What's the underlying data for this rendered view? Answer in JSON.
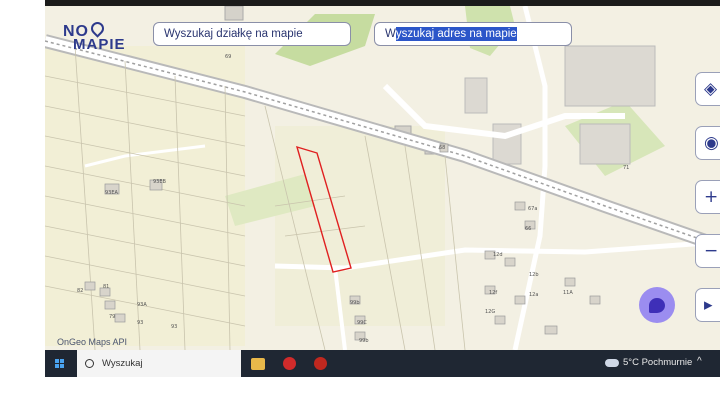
{
  "app": {
    "logo_line1": "NO",
    "logo_line2": "MAPIE"
  },
  "search": {
    "plot_placeholder": "Wyszukaj działkę na mapie",
    "address_prefix": "W",
    "address_value_selected": "yszukaj adres na mapie"
  },
  "controls": [
    {
      "name": "layers-icon",
      "glyph": "◈"
    },
    {
      "name": "locate-icon",
      "glyph": "◉"
    },
    {
      "name": "zoom-in-icon",
      "glyph": "+"
    },
    {
      "name": "zoom-out-icon",
      "glyph": "−"
    },
    {
      "name": "expand-icon",
      "glyph": "▸"
    }
  ],
  "map": {
    "attribution": "OnGeo Maps API",
    "plot_labels": [
      "93EA",
      "93EB",
      "68",
      "67a",
      "66",
      "71",
      "12a",
      "12b",
      "12d",
      "12f",
      "12G",
      "11A",
      "99b",
      "99C",
      "99b",
      "93A",
      "93",
      "93",
      "82",
      "81",
      "79",
      "78",
      "80",
      "69"
    ],
    "colors": {
      "background": "#f3f0e3",
      "highlight": "#e02020",
      "railway": "#a9a9a9",
      "green": "#c6dca0"
    }
  },
  "taskbar": {
    "search_label": "Wyszukaj",
    "weather": "5°C Pochmurnie",
    "tray": "^"
  }
}
